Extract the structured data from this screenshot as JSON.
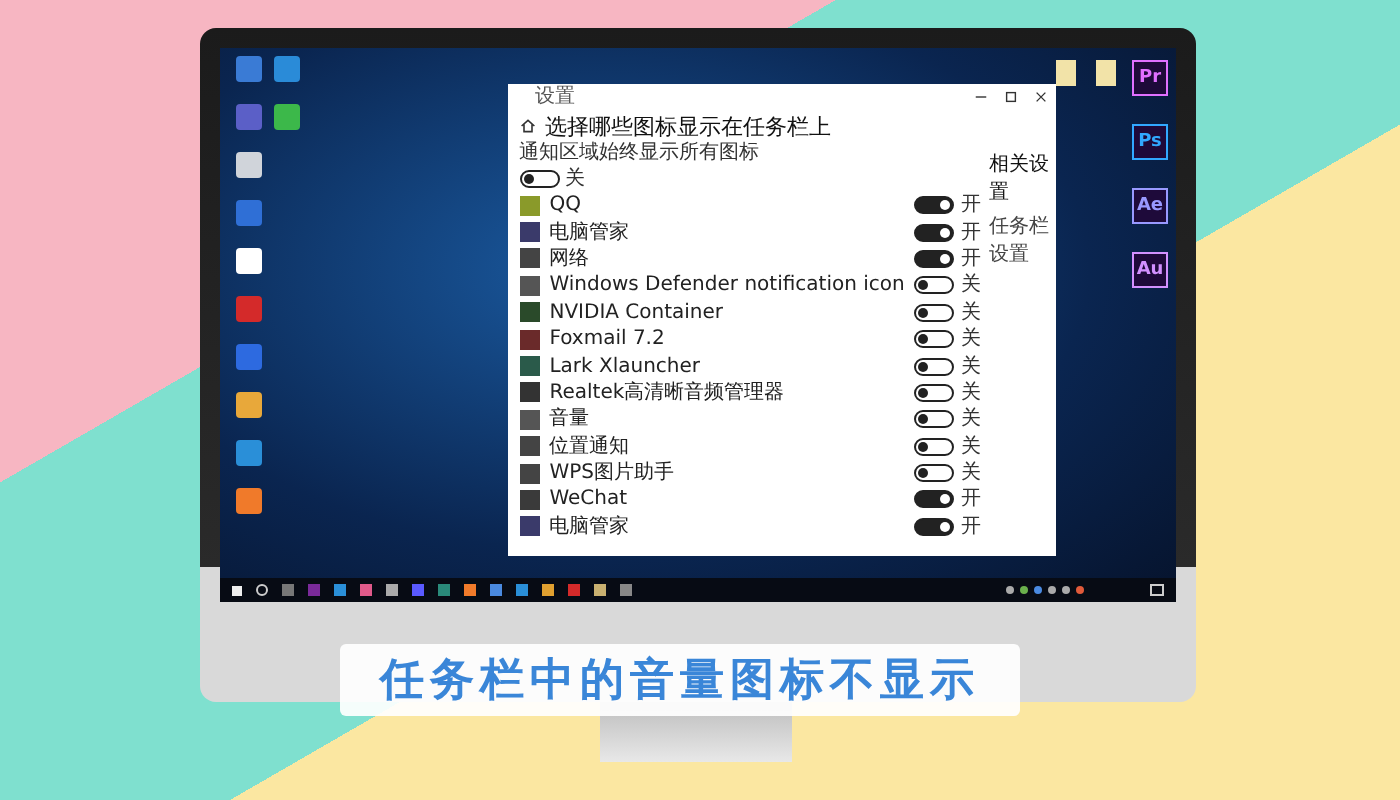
{
  "settings": {
    "header": "设置",
    "title": "选择哪些图标显示在任务栏上",
    "always_show": {
      "label": "通知区域始终显示所有图标",
      "on": false,
      "state_text": "关"
    },
    "items": [
      {
        "name": "QQ",
        "on": true,
        "state_text": "开"
      },
      {
        "name": "电脑管家",
        "on": true,
        "state_text": "开"
      },
      {
        "name": "网络",
        "on": true,
        "state_text": "开"
      },
      {
        "name": "Windows Defender notification icon",
        "on": false,
        "state_text": "关"
      },
      {
        "name": "NVIDIA Container",
        "on": false,
        "state_text": "关"
      },
      {
        "name": "Foxmail 7.2",
        "on": false,
        "state_text": "关"
      },
      {
        "name": "Lark Xlauncher",
        "on": false,
        "state_text": "关"
      },
      {
        "name": "Realtek高清晰音频管理器",
        "on": false,
        "state_text": "关"
      },
      {
        "name": "音量",
        "on": false,
        "state_text": "关"
      },
      {
        "name": "位置通知",
        "on": false,
        "state_text": "关"
      },
      {
        "name": "WPS图片助手",
        "on": false,
        "state_text": "关"
      },
      {
        "name": "WeChat",
        "on": true,
        "state_text": "开"
      },
      {
        "name": "电脑管家",
        "on": true,
        "state_text": "开"
      }
    ],
    "related": [
      "相关设置",
      "任务栏设置"
    ]
  },
  "adobe_apps": [
    "Pr",
    "Ps",
    "Ae",
    "Au"
  ],
  "caption": "任务栏中的音量图标不显示"
}
